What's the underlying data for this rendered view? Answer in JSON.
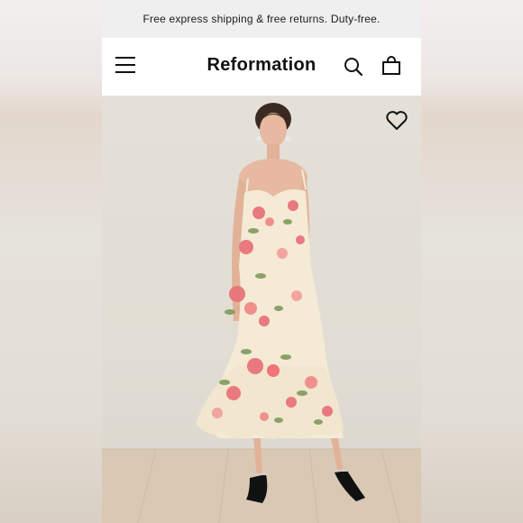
{
  "promo": {
    "text": "Free express shipping & free returns. Duty-free."
  },
  "header": {
    "brand": "Reformation"
  },
  "icons": {
    "menu": "hamburger-menu-icon",
    "search": "search-icon",
    "bag": "shopping-bag-icon",
    "wishlist": "heart-icon"
  },
  "colors": {
    "promo_bg": "#efefef",
    "header_bg": "#ffffff",
    "brand_text": "#111111",
    "dress_base": "#f4ead6",
    "floral_pink": "#e8747a",
    "floral_green": "#7f9a5c"
  }
}
